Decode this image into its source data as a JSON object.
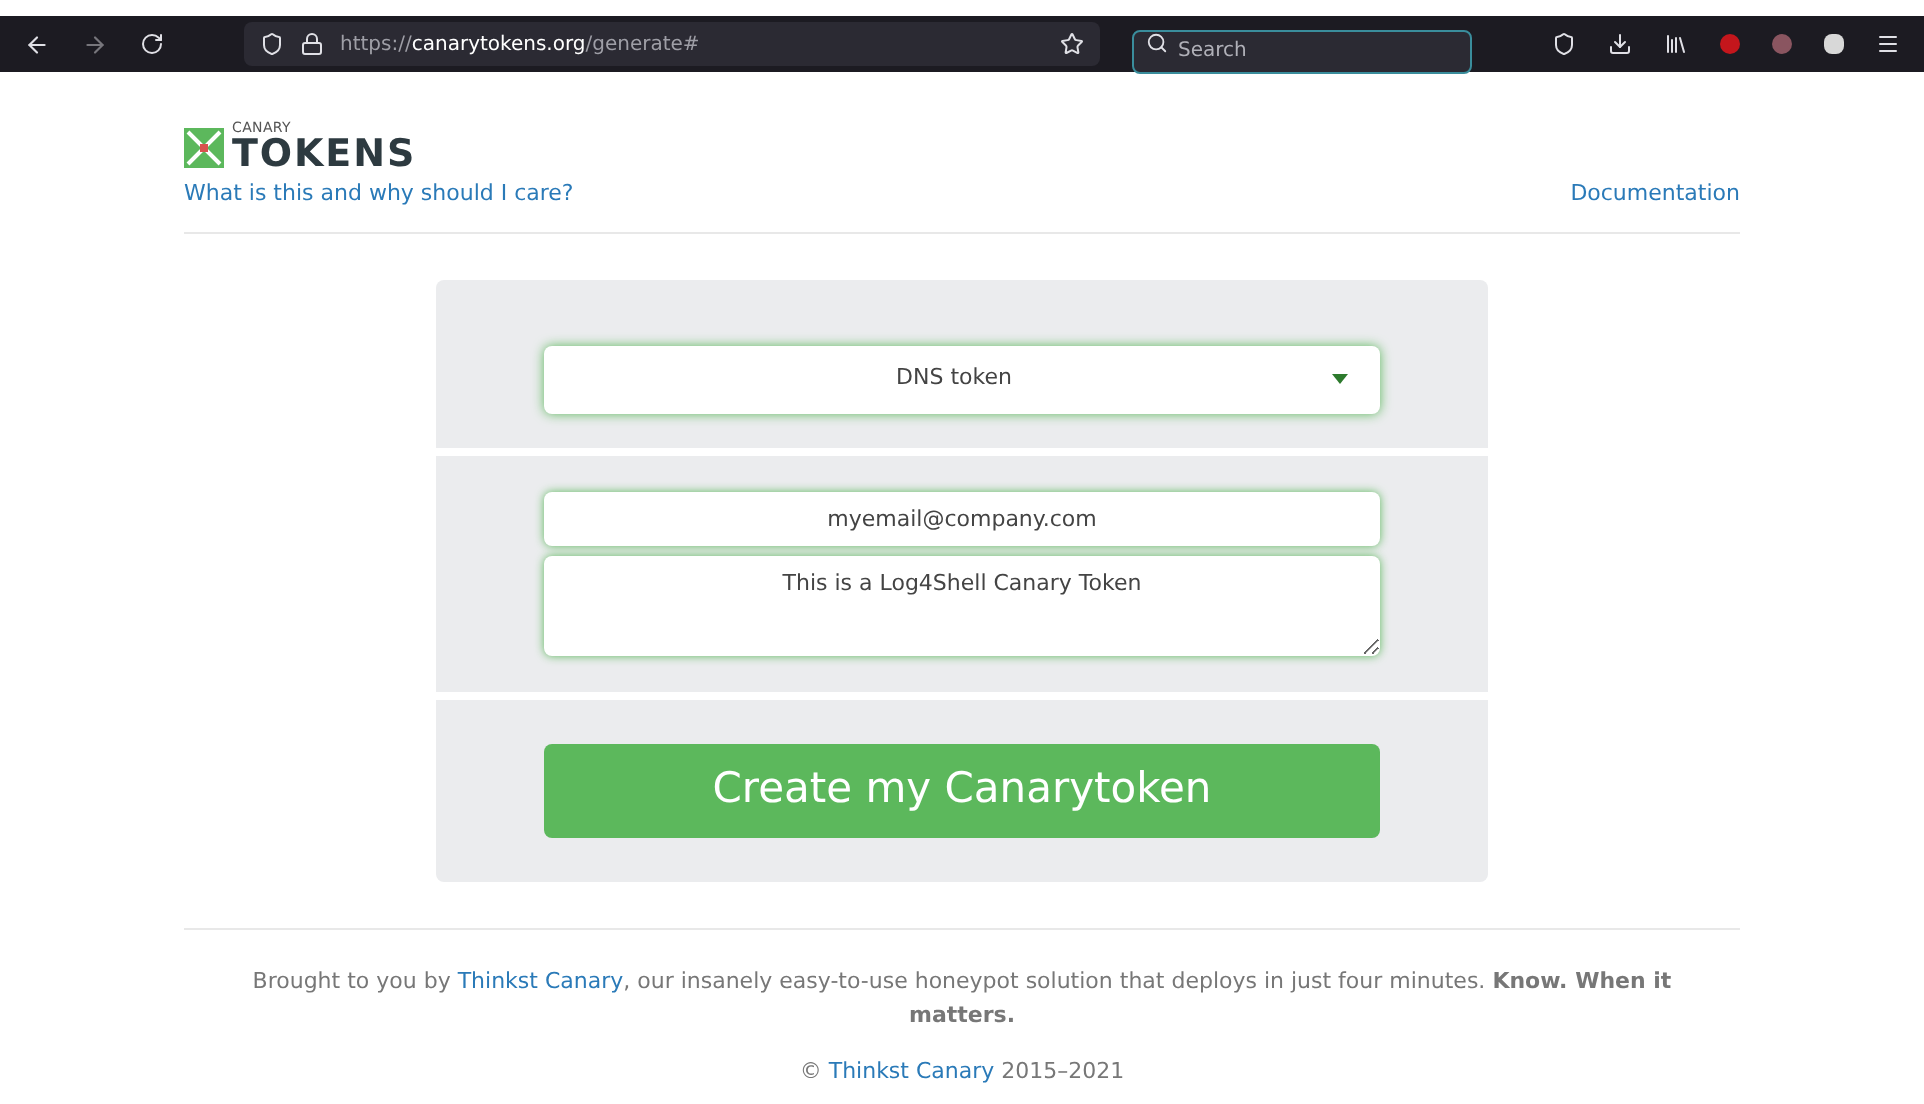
{
  "browser": {
    "url_prefix": "https://",
    "url_host": "canarytokens.org",
    "url_path": "/generate#",
    "search": {
      "placeholder": "Search"
    }
  },
  "header": {
    "logo_small": "CANARY",
    "logo_big": "TOKENS",
    "about_link": "What is this and why should I care?",
    "docs_link": "Documentation"
  },
  "form": {
    "token_type": "DNS token",
    "email": "myemail@company.com",
    "memo": "This is a Log4Shell Canary Token",
    "submit": "Create my Canarytoken"
  },
  "footer": {
    "before": "Brought to you by ",
    "link": "Thinkst Canary",
    "after": ", our insanely easy-to-use honeypot solution that deploys in just four minutes. **Know. When it matters.**",
    "copyright_mark": "©",
    "copyright_link": "Thinkst Canary",
    "years": "2015–2021"
  }
}
